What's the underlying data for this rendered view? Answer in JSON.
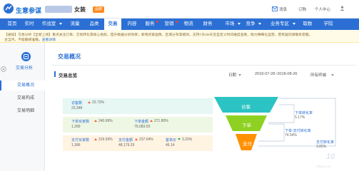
{
  "header": {
    "app_name": "生意参谋",
    "shop_name": "女装",
    "shop_badge": "品牌",
    "messages": "消息",
    "order": "订购",
    "personal_center": "个人中心"
  },
  "nav": {
    "items": [
      {
        "label": "首页"
      },
      {
        "label": "实时"
      },
      {
        "label": "作战室"
      },
      {
        "label": "流量"
      },
      {
        "label": "品类"
      },
      {
        "label": "交易"
      },
      {
        "label": "内容"
      },
      {
        "label": "服务"
      },
      {
        "label": "营销"
      },
      {
        "label": "物流"
      },
      {
        "label": "财务"
      },
      {
        "label": "市场"
      },
      {
        "label": "竞争"
      },
      {
        "label": "业务专区"
      },
      {
        "label": "取数"
      },
      {
        "label": "学院"
      }
    ],
    "active": "交易"
  },
  "notice": {
    "line1": "【通知】交易分析【全新上线】重点关注订单、交易转化等核心指标，提升数据分析效率；新增买家画像、区域分布等模块，支持7天/30天及自定义时间维度查看，助力精细化运营。若有疑问请联系客服，",
    "line2": "台当月，不能确保准确，",
    "link": "查看详情"
  },
  "sidebar": {
    "title": "交易分析",
    "items": [
      {
        "label": "交易概况"
      },
      {
        "label": "交易构成"
      },
      {
        "label": "交易明细"
      }
    ]
  },
  "main": {
    "page_title": "交易概况",
    "section_title": "交易总览",
    "date_label": "日期",
    "date_range": "2018-07-28~2018-08-26",
    "terminal": "所有终端"
  },
  "metrics": {
    "visitors": {
      "label": "访客数",
      "value": "23,348",
      "change": "22.73%"
    },
    "order_buyers": {
      "label": "下单买家数",
      "value": "1,399",
      "change": "240.69%"
    },
    "order_amount": {
      "label": "下单金额",
      "value": "75,083.09",
      "change": "271.80%"
    },
    "pay_buyers": {
      "label": "支付买家数",
      "value": "1,386",
      "change": "319.93%"
    },
    "pay_amount": {
      "label": "支付金额",
      "value": "48,179.29",
      "change": "237.04%"
    },
    "unit_price": {
      "label": "客单价",
      "value": "46.14",
      "change": "3.20%"
    }
  },
  "funnel": {
    "stage1": "访客",
    "stage2": "下单",
    "stage3": "支付",
    "conv_order_label": "下单转化率",
    "conv_order_value": "5.17%",
    "conv_pay_label": "下单-支付转化率",
    "conv_pay_value": "74.54%",
    "conv_total_label": "支付转化率",
    "conv_total_value": "3.85%"
  },
  "watermark": {
    "text": "10",
    "sub": "10sej.com"
  },
  "colors": {
    "brand": "#2b6fd5",
    "funnel_top": "#2bc3c3",
    "funnel_mid": "#8fd122",
    "funnel_bottom": "#ff9000",
    "up": "#ff5a3c",
    "down": "#27b069"
  }
}
